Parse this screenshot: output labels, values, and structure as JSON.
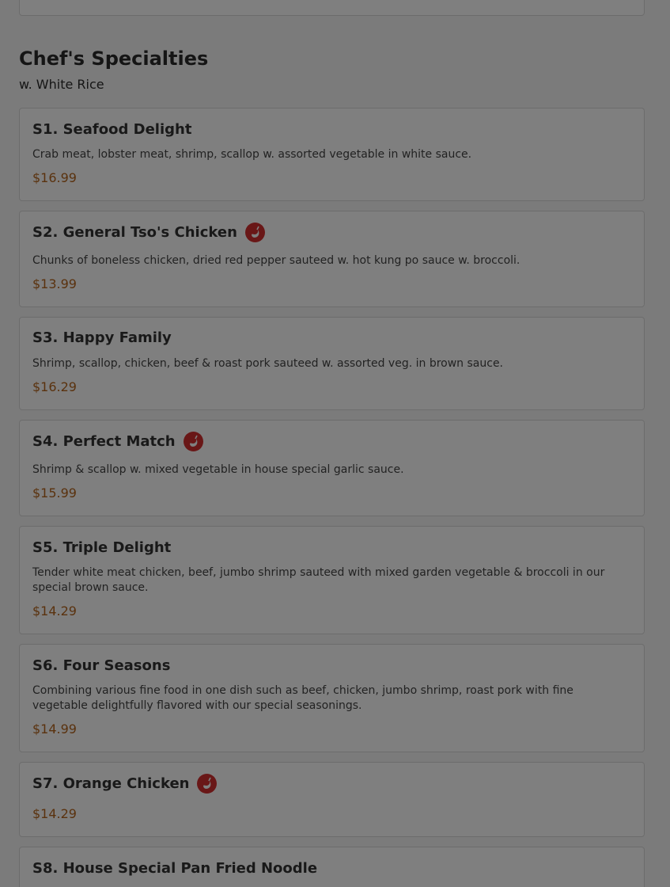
{
  "section": {
    "title": "Chef's Specialties",
    "subtitle": "w. White Rice"
  },
  "items": [
    {
      "name": "S1. Seafood Delight",
      "desc": "Crab meat, lobster meat, shrimp, scallop w. assorted vegetable in white sauce.",
      "price": "$16.99",
      "spicy": false
    },
    {
      "name": "S2. General Tso's Chicken",
      "desc": "Chunks of boneless chicken, dried red pepper sauteed w. hot kung po sauce w. broccoli.",
      "price": "$13.99",
      "spicy": true
    },
    {
      "name": "S3. Happy Family",
      "desc": "Shrimp, scallop, chicken, beef & roast pork sauteed w. assorted veg. in brown sauce.",
      "price": "$16.29",
      "spicy": false
    },
    {
      "name": "S4. Perfect Match",
      "desc": "Shrimp & scallop w. mixed vegetable in house special garlic sauce.",
      "price": "$15.99",
      "spicy": true
    },
    {
      "name": "S5. Triple Delight",
      "desc": "Tender white meat chicken, beef, jumbo shrimp sauteed with mixed garden vegetable & broccoli in our special brown sauce.",
      "price": "$14.29",
      "spicy": false
    },
    {
      "name": "S6. Four Seasons",
      "desc": "Combining various fine food in one dish such as beef, chicken, jumbo shrimp, roast pork with fine vegetable delightfully flavored with our special seasonings.",
      "price": "$14.99",
      "spicy": false
    },
    {
      "name": "S7. Orange Chicken",
      "desc": "",
      "price": "$14.29",
      "spicy": true
    },
    {
      "name": "S8. House Special Pan Fried Noodle",
      "desc": "",
      "price": "",
      "spicy": false
    }
  ]
}
